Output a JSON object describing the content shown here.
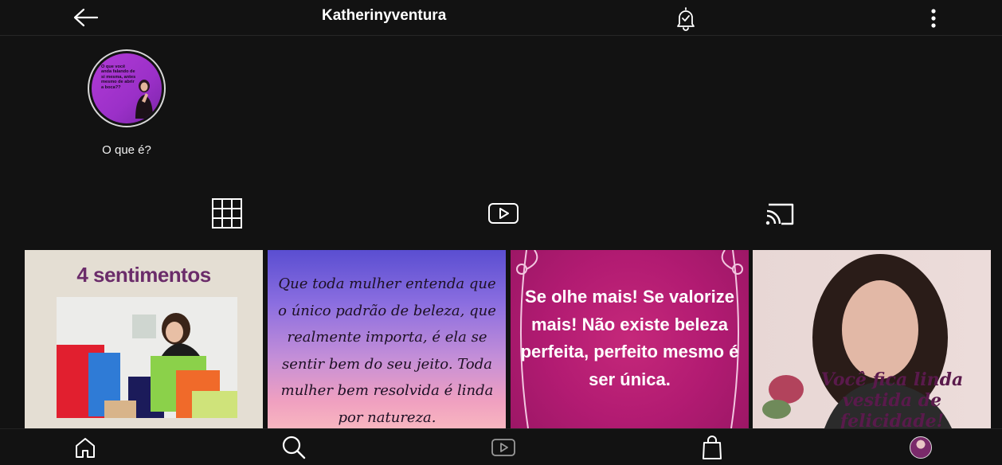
{
  "header": {
    "title": "Katherinyventura"
  },
  "highlights": [
    {
      "label": "O que é?",
      "cover_text": "O que você anda falando de si mesma, antes mesmo de abrir a boca??"
    }
  ],
  "posts": [
    {
      "caption": "4 sentimentos"
    },
    {
      "text": "Que toda mulher entenda que o único padrão de beleza, que realmente importa, é ela se sentir bem do seu jeito. Toda mulher bem resolvida é linda por natureza."
    },
    {
      "text": "Se olhe mais! Se valorize mais! Não existe beleza perfeita, perfeito mesmo é ser única."
    },
    {
      "text": "Você fica linda vestida de felicidade!"
    }
  ],
  "icons": {
    "back": "arrow-left-icon",
    "bell": "bell-check-icon",
    "more": "more-vertical-icon",
    "grid_tab": "grid-icon",
    "video_tab": "play-icon",
    "cast_tab": "cast-icon",
    "nav_home": "home-icon",
    "nav_search": "search-icon",
    "nav_video": "play-icon",
    "nav_shop": "shopping-bag-icon",
    "nav_profile": "avatar"
  },
  "colors": {
    "background": "#121212",
    "highlight_purple": "#b13ad6",
    "caption_plum": "#6b2c6a",
    "magenta_post": "#b21b72"
  }
}
